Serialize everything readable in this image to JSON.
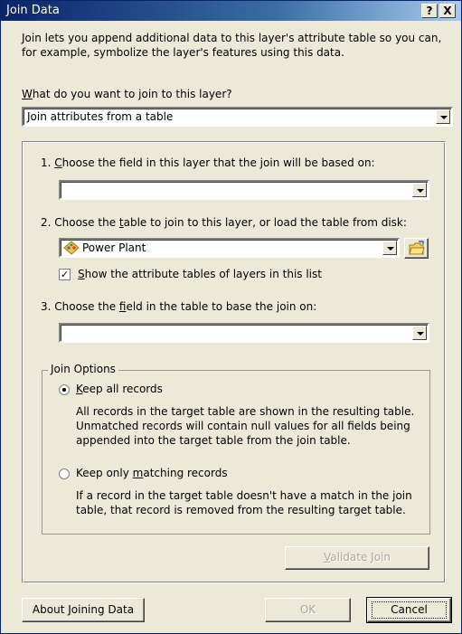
{
  "window": {
    "title": "Join Data",
    "help_glyph": "?",
    "close_glyph": "X"
  },
  "intro": {
    "line1": "Join lets you append additional data to this layer's attribute table so you can,",
    "line2": "for example, symbolize the layer's features using this data."
  },
  "join_type": {
    "label_prefix": "",
    "label_mnemonic": "W",
    "label_rest": "hat do you want to join to this layer?",
    "selected": "Join attributes from a table"
  },
  "step1": {
    "label_a": "1.  ",
    "label_mn": "C",
    "label_b": "hoose the field in this layer that the join will be based on:",
    "selected": ""
  },
  "step2": {
    "label_a": "2.  Choose the ",
    "label_mn": "t",
    "label_b": "able to join to this layer, or load the table from disk:",
    "selected": "Power Plant",
    "layer_icon": "feature-layer-icon",
    "browse_icon": "open-folder-icon",
    "checkbox_checked": true,
    "checkbox_glyph": "✓",
    "checkbox_mn": "S",
    "checkbox_rest": "how the attribute tables of layers in this list"
  },
  "step3": {
    "label_a": "3.  Choose the ",
    "label_mn": "f",
    "label_b": "ield in the table to base the join on:",
    "selected": ""
  },
  "join_options": {
    "legend": "Join Options",
    "keep_all": {
      "mn": "K",
      "rest": "eep all records",
      "selected": true,
      "desc1": "All records in the target table are shown in the resulting table.",
      "desc2": "Unmatched records will contain null values for all fields being",
      "desc3": "appended into the target table from the join table."
    },
    "keep_matching": {
      "pre": "Keep only ",
      "mn": "m",
      "rest": "atching records",
      "selected": false,
      "desc1": "If a record in the target table doesn't have a match in the join",
      "desc2": "table, that record is removed from the resulting target table."
    },
    "validate": {
      "mn": "V",
      "rest": "alidate Join",
      "enabled": false
    }
  },
  "footer": {
    "about_a": "About ",
    "about_mn": "J",
    "about_b": "oining Data",
    "ok": "OK",
    "ok_enabled": false,
    "cancel": "Cancel"
  },
  "colors": {
    "title_start": "#0a246a",
    "title_end": "#a6caf0",
    "face": "#ece9d8",
    "disabled_text": "#aca899"
  }
}
